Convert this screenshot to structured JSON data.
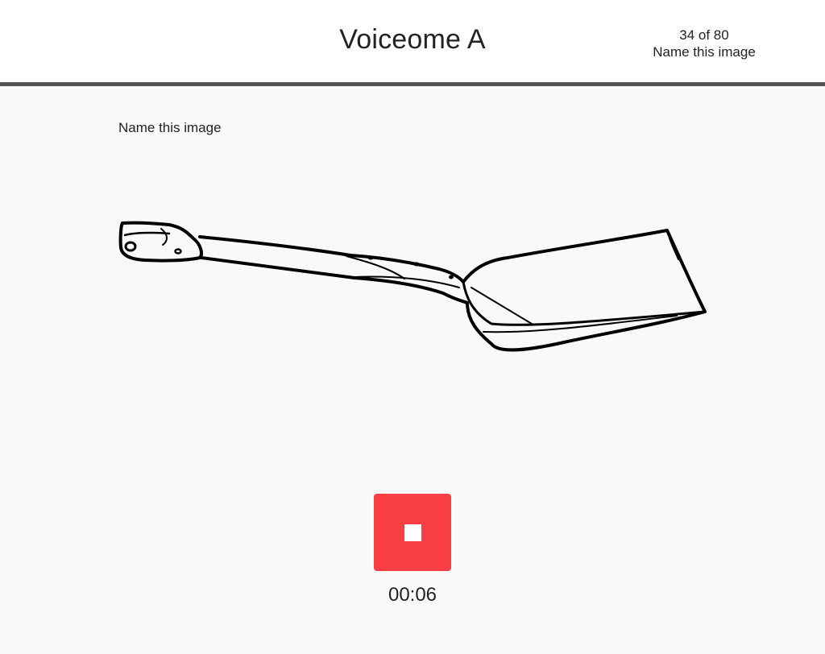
{
  "header": {
    "title": "Voiceome A",
    "progress_count": "34 of 80",
    "progress_task": "Name this image"
  },
  "main": {
    "prompt": "Name this image",
    "stimulus_icon": "shovel-drawing",
    "recorder": {
      "stop_icon": "stop-icon",
      "elapsed": "00:06",
      "button_color": "#f93f44"
    }
  }
}
